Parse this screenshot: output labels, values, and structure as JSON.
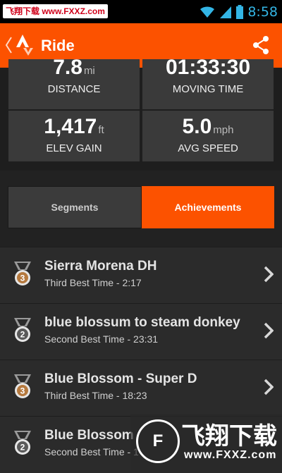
{
  "status_bar": {
    "watermark": "飞翔下载 www.FXXZ.com",
    "time": "8:58"
  },
  "app_bar": {
    "title": "Ride",
    "icons": [
      "back-chevron-icon",
      "strava-logo-icon",
      "share-icon"
    ]
  },
  "stats": {
    "distance": {
      "value": "7.8",
      "unit": "mi",
      "label": "DISTANCE"
    },
    "moving_time": {
      "value": "01:33:30",
      "unit": "",
      "label": "MOVING TIME"
    },
    "elev_gain": {
      "value": "1,417",
      "unit": "ft",
      "label": "ELEV GAIN"
    },
    "avg_speed": {
      "value": "5.0",
      "unit": "mph",
      "label": "AVG SPEED"
    }
  },
  "tabs": [
    {
      "label": "Segments",
      "active": false
    },
    {
      "label": "Achievements",
      "active": true
    }
  ],
  "achievements": [
    {
      "name": "Sierra Morena DH",
      "detail": "Third Best Time - 2:17",
      "rank": "3",
      "medal": "bronze"
    },
    {
      "name": "blue blossum to steam donkey",
      "detail": "Second Best Time - 23:31",
      "rank": "2",
      "medal": "silver"
    },
    {
      "name": "Blue Blossom - Super D",
      "detail": "Third Best Time - 18:23",
      "rank": "3",
      "medal": "bronze"
    },
    {
      "name": "Blue Blossom",
      "detail": "Second Best Time - 1",
      "rank": "2",
      "medal": "silver"
    }
  ],
  "watermark_bottom": {
    "logo_text": "F",
    "text": "飞翔下载",
    "url": "www.FXXZ.com"
  },
  "colors": {
    "accent": "#fc5200",
    "clock": "#33b5e5",
    "bronze": "#b5793e",
    "silver": "#c8c8c8"
  }
}
